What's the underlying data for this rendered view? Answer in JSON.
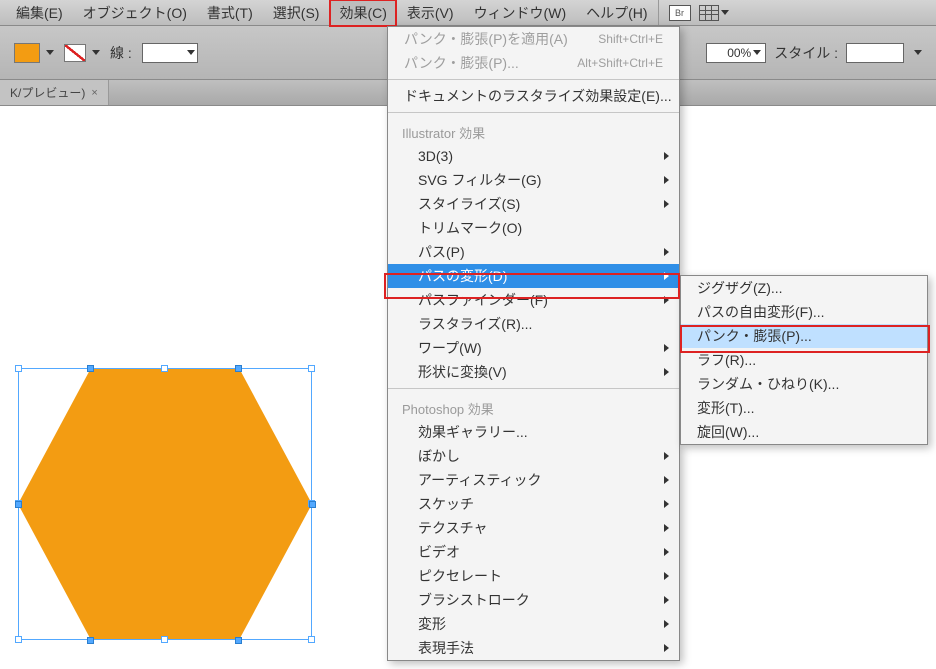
{
  "menubar": {
    "items": [
      "編集(E)",
      "オブジェクト(O)",
      "書式(T)",
      "選択(S)",
      "効果(C)",
      "表示(V)",
      "ウィンドウ(W)",
      "ヘルプ(H)"
    ],
    "active_index": 4,
    "br_label": "Br"
  },
  "toolbar": {
    "stroke_label": "線 :",
    "opacity_value": "00%",
    "style_label": "スタイル :"
  },
  "tab": {
    "label": "K/プレビュー)",
    "close": "×"
  },
  "menu": {
    "apply_last": "パンク・膨張(P)を適用(A)",
    "apply_last_sc": "Shift+Ctrl+E",
    "last_effect": "パンク・膨張(P)...",
    "last_effect_sc": "Alt+Shift+Ctrl+E",
    "raster_settings": "ドキュメントのラスタライズ効果設定(E)...",
    "illustrator_section": "Illustrator 効果",
    "ai": {
      "threeD": "3D(3)",
      "svg": "SVG フィルター(G)",
      "stylize": "スタイライズ(S)",
      "trim": "トリムマーク(O)",
      "path": "パス(P)",
      "distort": "パスの変形(D)",
      "pathfinder": "パスファインダー(F)",
      "rasterize": "ラスタライズ(R)...",
      "warp": "ワープ(W)",
      "convert": "形状に変換(V)"
    },
    "photoshop_section": "Photoshop 効果",
    "ps": {
      "gallery": "効果ギャラリー...",
      "blur": "ぼかし",
      "artistic": "アーティスティック",
      "sketch": "スケッチ",
      "texture": "テクスチャ",
      "video": "ビデオ",
      "pixelate": "ピクセレート",
      "brush": "ブラシストローク",
      "distort2": "変形",
      "stylize2": "表現手法"
    }
  },
  "submenu": {
    "zigzag": "ジグザグ(Z)...",
    "free": "パスの自由変形(F)...",
    "pucker": "パンク・膨張(P)...",
    "rough": "ラフ(R)...",
    "random": "ランダム・ひねり(K)...",
    "transform": "変形(T)...",
    "twist": "旋回(W)..."
  },
  "colors": {
    "hexagon": "#f39c12",
    "selection": "#52a8ff"
  }
}
